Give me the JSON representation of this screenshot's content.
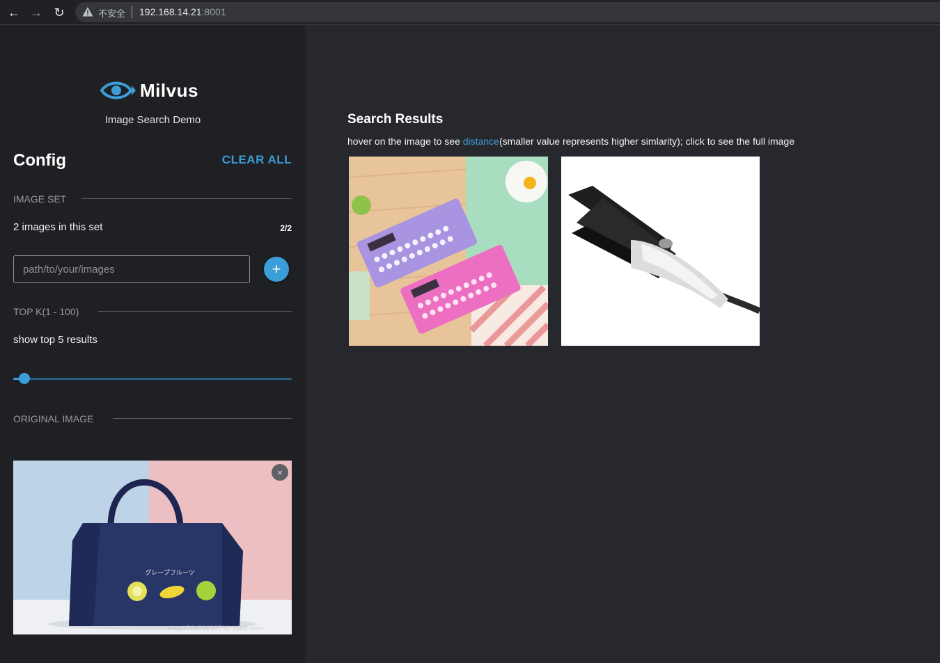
{
  "browser": {
    "insecure_label": "不安全",
    "url_host": "192.168.14.21",
    "url_port": ":8001"
  },
  "sidebar": {
    "logo_text": "Milvus",
    "subtitle": "Image Search Demo",
    "config_title": "Config",
    "clear_all_label": "CLEAR ALL",
    "image_set": {
      "heading": "IMAGE SET",
      "info": "2 images in this set",
      "count": "2/2",
      "path_placeholder": "path/to/your/images",
      "add_button": "+"
    },
    "top_k": {
      "heading": "TOP K(1 - 100)",
      "info": "show top 5 results",
      "value": 5,
      "min": 1,
      "max": 100
    },
    "original_image": {
      "heading": "ORIGINAL IMAGE",
      "bag_text": "グレープフルーツ",
      "watermark": "shop176x58638531.1688.com",
      "close_label": "×"
    }
  },
  "main": {
    "results_title": "Search Results",
    "hint_prefix": "hover on the image to see ",
    "hint_link": "distance",
    "hint_suffix": "(smaller value represents higher simlarity); click to see the full image",
    "results": [
      {
        "name": "calculator-ruler-image"
      },
      {
        "name": "hair-curler-image"
      }
    ]
  },
  "colors": {
    "accent": "#3b9ed9",
    "sidebar_bg": "#1f2024",
    "main_bg": "#27282e"
  }
}
